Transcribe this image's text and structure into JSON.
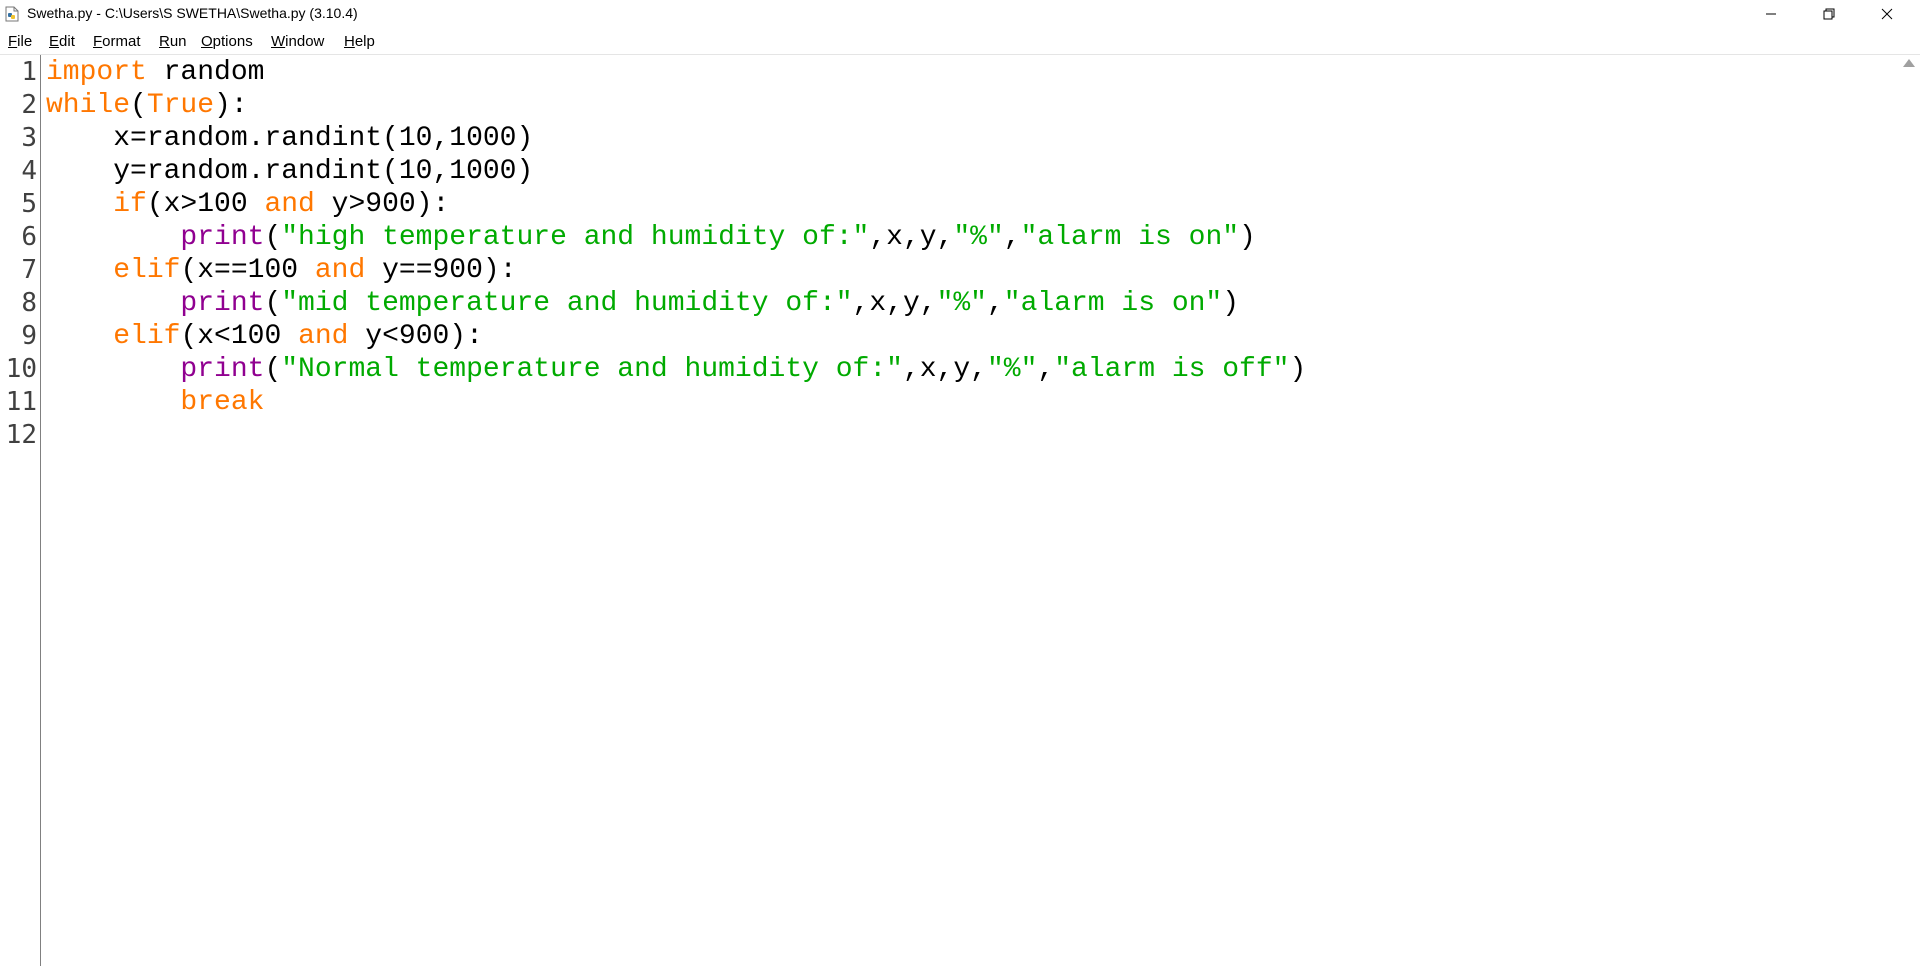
{
  "window": {
    "title": "Swetha.py - C:\\Users\\S SWETHA\\Swetha.py (3.10.4)",
    "icon": "python-file-icon"
  },
  "menu": [
    {
      "label": "File",
      "underline": "F",
      "rest": "ile"
    },
    {
      "label": "Edit",
      "underline": "E",
      "rest": "dit"
    },
    {
      "label": "Format",
      "underline": "F",
      "rest": "ormat"
    },
    {
      "label": "Run",
      "underline": "R",
      "rest": "un"
    },
    {
      "label": "Options",
      "underline": "O",
      "rest": "ptions"
    },
    {
      "label": "Window",
      "underline": "W",
      "rest": "indow"
    },
    {
      "label": "Help",
      "underline": "H",
      "rest": "elp"
    }
  ],
  "line_numbers": [
    "1",
    "2",
    "3",
    "4",
    "5",
    "6",
    "7",
    "8",
    "9",
    "10",
    "11",
    "12"
  ],
  "code": [
    [
      [
        "kw",
        "import"
      ],
      [
        "plain",
        " random"
      ]
    ],
    [
      [
        "kw",
        "while"
      ],
      [
        "plain",
        "("
      ],
      [
        "kw",
        "True"
      ],
      [
        "plain",
        "):"
      ]
    ],
    [
      [
        "plain",
        "    x=random.randint(10,1000)"
      ]
    ],
    [
      [
        "plain",
        "    y=random.randint(10,1000)"
      ]
    ],
    [
      [
        "plain",
        "    "
      ],
      [
        "kw",
        "if"
      ],
      [
        "plain",
        "(x>100 "
      ],
      [
        "kw",
        "and"
      ],
      [
        "plain",
        " y>900):"
      ]
    ],
    [
      [
        "plain",
        "        "
      ],
      [
        "bi",
        "print"
      ],
      [
        "plain",
        "("
      ],
      [
        "str",
        "\"high temperature and humidity of:\""
      ],
      [
        "plain",
        ",x,y,"
      ],
      [
        "str",
        "\"%\""
      ],
      [
        "plain",
        ","
      ],
      [
        "str",
        "\"alarm is on\""
      ],
      [
        "plain",
        ")"
      ]
    ],
    [
      [
        "plain",
        "    "
      ],
      [
        "kw",
        "elif"
      ],
      [
        "plain",
        "(x==100 "
      ],
      [
        "kw",
        "and"
      ],
      [
        "plain",
        " y==900):"
      ]
    ],
    [
      [
        "plain",
        "        "
      ],
      [
        "bi",
        "print"
      ],
      [
        "plain",
        "("
      ],
      [
        "str",
        "\"mid temperature and humidity of:\""
      ],
      [
        "plain",
        ",x,y,"
      ],
      [
        "str",
        "\"%\""
      ],
      [
        "plain",
        ","
      ],
      [
        "str",
        "\"alarm is on\""
      ],
      [
        "plain",
        ")"
      ]
    ],
    [
      [
        "plain",
        "    "
      ],
      [
        "kw",
        "elif"
      ],
      [
        "plain",
        "(x<100 "
      ],
      [
        "kw",
        "and"
      ],
      [
        "plain",
        " y<900):"
      ]
    ],
    [
      [
        "plain",
        "        "
      ],
      [
        "bi",
        "print"
      ],
      [
        "plain",
        "("
      ],
      [
        "str",
        "\"Normal temperature and humidity of:\""
      ],
      [
        "plain",
        ",x,y,"
      ],
      [
        "str",
        "\"%\""
      ],
      [
        "plain",
        ","
      ],
      [
        "str",
        "\"alarm is off\""
      ],
      [
        "plain",
        ")"
      ]
    ],
    [
      [
        "plain",
        "        "
      ],
      [
        "kw",
        "break"
      ]
    ],
    []
  ],
  "colors": {
    "keyword": "#ff7700",
    "builtin": "#900090",
    "string": "#00aa00",
    "text": "#000000"
  }
}
